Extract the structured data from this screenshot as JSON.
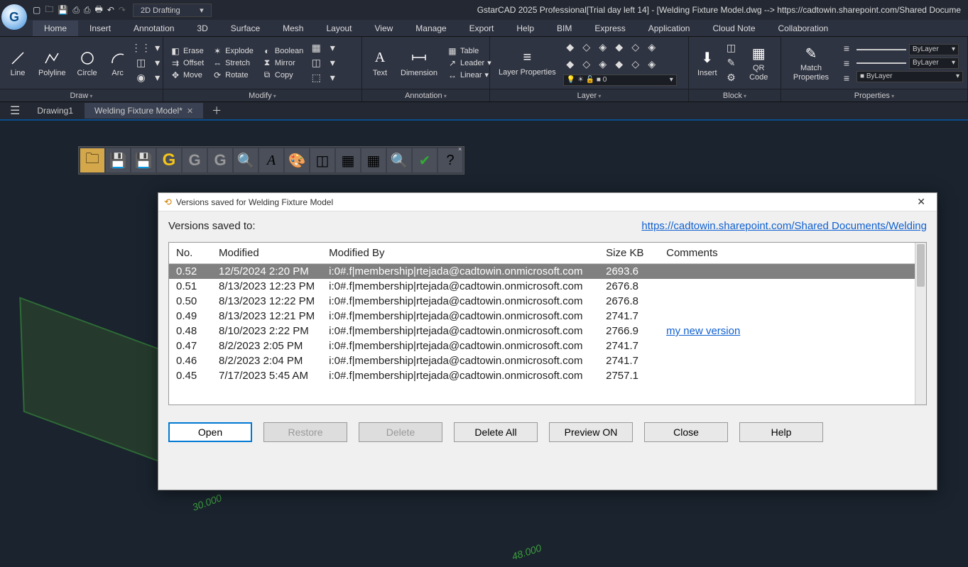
{
  "app": {
    "title": "GstarCAD 2025 Professional[Trial day left 14] - [Welding Fixture Model.dwg --> https://cadtowin.sharepoint.com/Shared Docume",
    "workspace": "2D Drafting",
    "logo_letter": "G"
  },
  "menu": [
    "Home",
    "Insert",
    "Annotation",
    "3D",
    "Surface",
    "Mesh",
    "Layout",
    "View",
    "Manage",
    "Export",
    "Help",
    "BIM",
    "Express",
    "Application",
    "Cloud Note",
    "Collaboration"
  ],
  "menu_active": 0,
  "ribbon": {
    "draw": {
      "title": "Draw",
      "line": "Line",
      "polyline": "Polyline",
      "circle": "Circle",
      "arc": "Arc"
    },
    "modify": {
      "title": "Modify",
      "erase": "Erase",
      "explode": "Explode",
      "boolean": "Boolean",
      "offset": "Offset",
      "stretch": "Stretch",
      "mirror": "Mirror",
      "move": "Move",
      "rotate": "Rotate",
      "copy": "Copy"
    },
    "annotation": {
      "title": "Annotation",
      "text": "Text",
      "dimension": "Dimension",
      "table": "Table",
      "leader": "Leader",
      "linear": "Linear"
    },
    "layer": {
      "title": "Layer",
      "props": "Layer Properties",
      "zero": "0"
    },
    "block": {
      "title": "Block",
      "insert": "Insert",
      "qr": "QR Code"
    },
    "properties": {
      "title": "Properties",
      "match": "Match Properties",
      "bylayer": "ByLayer"
    }
  },
  "doctabs": {
    "tab1": "Drawing1",
    "tab2": "Welding Fixture Model*"
  },
  "dialog": {
    "title": "Versions saved for Welding Fixture Model",
    "saved_to": "Versions saved to:",
    "url": "https://cadtowin.sharepoint.com/Shared Documents/Welding",
    "headers": {
      "no": "No.",
      "modified": "Modified",
      "by": "Modified By",
      "size": "Size KB",
      "comments": "Comments"
    },
    "rows": [
      {
        "no": "0.52",
        "mod": "12/5/2024 2:20 PM",
        "by": "i:0#.f|membership|rtejada@cadtowin.onmicrosoft.com",
        "size": "2693.6",
        "comment": ""
      },
      {
        "no": "0.51",
        "mod": "8/13/2023 12:23 PM",
        "by": "i:0#.f|membership|rtejada@cadtowin.onmicrosoft.com",
        "size": "2676.8",
        "comment": ""
      },
      {
        "no": "0.50",
        "mod": "8/13/2023 12:22 PM",
        "by": "i:0#.f|membership|rtejada@cadtowin.onmicrosoft.com",
        "size": "2676.8",
        "comment": ""
      },
      {
        "no": "0.49",
        "mod": "8/13/2023 12:21 PM",
        "by": "i:0#.f|membership|rtejada@cadtowin.onmicrosoft.com",
        "size": "2741.7",
        "comment": ""
      },
      {
        "no": "0.48",
        "mod": "8/10/2023 2:22 PM",
        "by": "i:0#.f|membership|rtejada@cadtowin.onmicrosoft.com",
        "size": "2766.9",
        "comment": "my new version"
      },
      {
        "no": "0.47",
        "mod": "8/2/2023 2:05 PM",
        "by": "i:0#.f|membership|rtejada@cadtowin.onmicrosoft.com",
        "size": "2741.7",
        "comment": ""
      },
      {
        "no": "0.46",
        "mod": "8/2/2023 2:04 PM",
        "by": "i:0#.f|membership|rtejada@cadtowin.onmicrosoft.com",
        "size": "2741.7",
        "comment": ""
      },
      {
        "no": "0.45",
        "mod": "7/17/2023 5:45 AM",
        "by": "i:0#.f|membership|rtejada@cadtowin.onmicrosoft.com",
        "size": "2757.1",
        "comment": ""
      }
    ],
    "buttons": {
      "open": "Open",
      "restore": "Restore",
      "delete": "Delete",
      "delete_all": "Delete All",
      "preview": "Preview ON",
      "close": "Close",
      "help": "Help"
    }
  },
  "canvas_dims": {
    "d1": "30.000",
    "d2": "48.000"
  }
}
